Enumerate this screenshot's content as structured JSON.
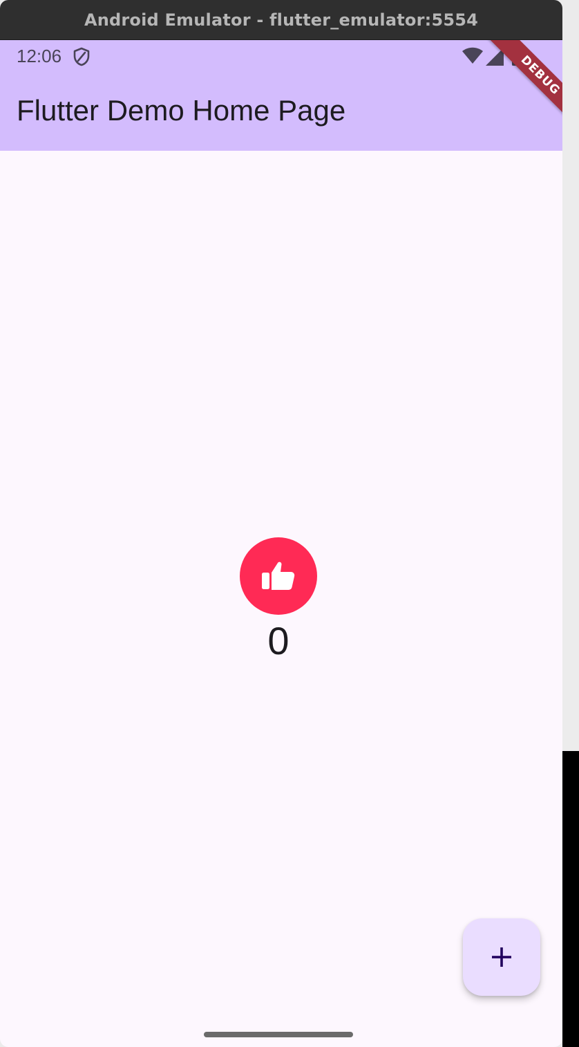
{
  "window": {
    "title": "Android Emulator - flutter_emulator:5554"
  },
  "status_bar": {
    "time": "12:06",
    "icons": [
      "shield-icon",
      "wifi-icon",
      "signal-icon",
      "battery-icon"
    ]
  },
  "app_bar": {
    "title": "Flutter Demo Home Page",
    "debug_banner": "DEBUG"
  },
  "content": {
    "like_icon": "thumbs-up-icon",
    "counter": "0"
  },
  "fab": {
    "icon": "plus-icon"
  },
  "colors": {
    "app_bar": "#d3bcfd",
    "background": "#fdf7fe",
    "like_button": "#ff2a55",
    "fab": "#eaddff",
    "debug_banner": "#a3313f"
  }
}
